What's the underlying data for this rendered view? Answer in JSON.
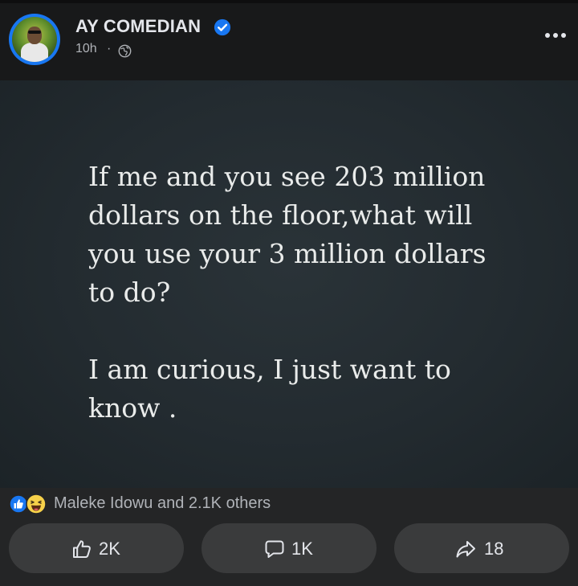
{
  "post": {
    "author": "AY COMEDIAN",
    "time": "10h",
    "separator": "·",
    "verified": true,
    "audience_icon": "globe-icon",
    "more_icon": "more-horizontal-icon",
    "content_paragraphs": [
      "If me and you see 203 million\ndollars on the floor,what will\nyou use your 3 million dollars\nto do?",
      "I am curious, I just want to\nknow ."
    ]
  },
  "reactions": {
    "icons": [
      "like-reaction-icon",
      "haha-reaction-icon"
    ],
    "summary": "Maleke Idowu and 2.1K others"
  },
  "actions": {
    "like_count": "2K",
    "comment_count": "1K",
    "share_count": "18"
  },
  "colors": {
    "accent": "#1877f2",
    "background": "#18191a",
    "card": "#242526",
    "button": "#3a3b3c",
    "text_primary": "#e4e6eb",
    "text_secondary": "#b0b3b8",
    "image_background": "#252d32"
  }
}
